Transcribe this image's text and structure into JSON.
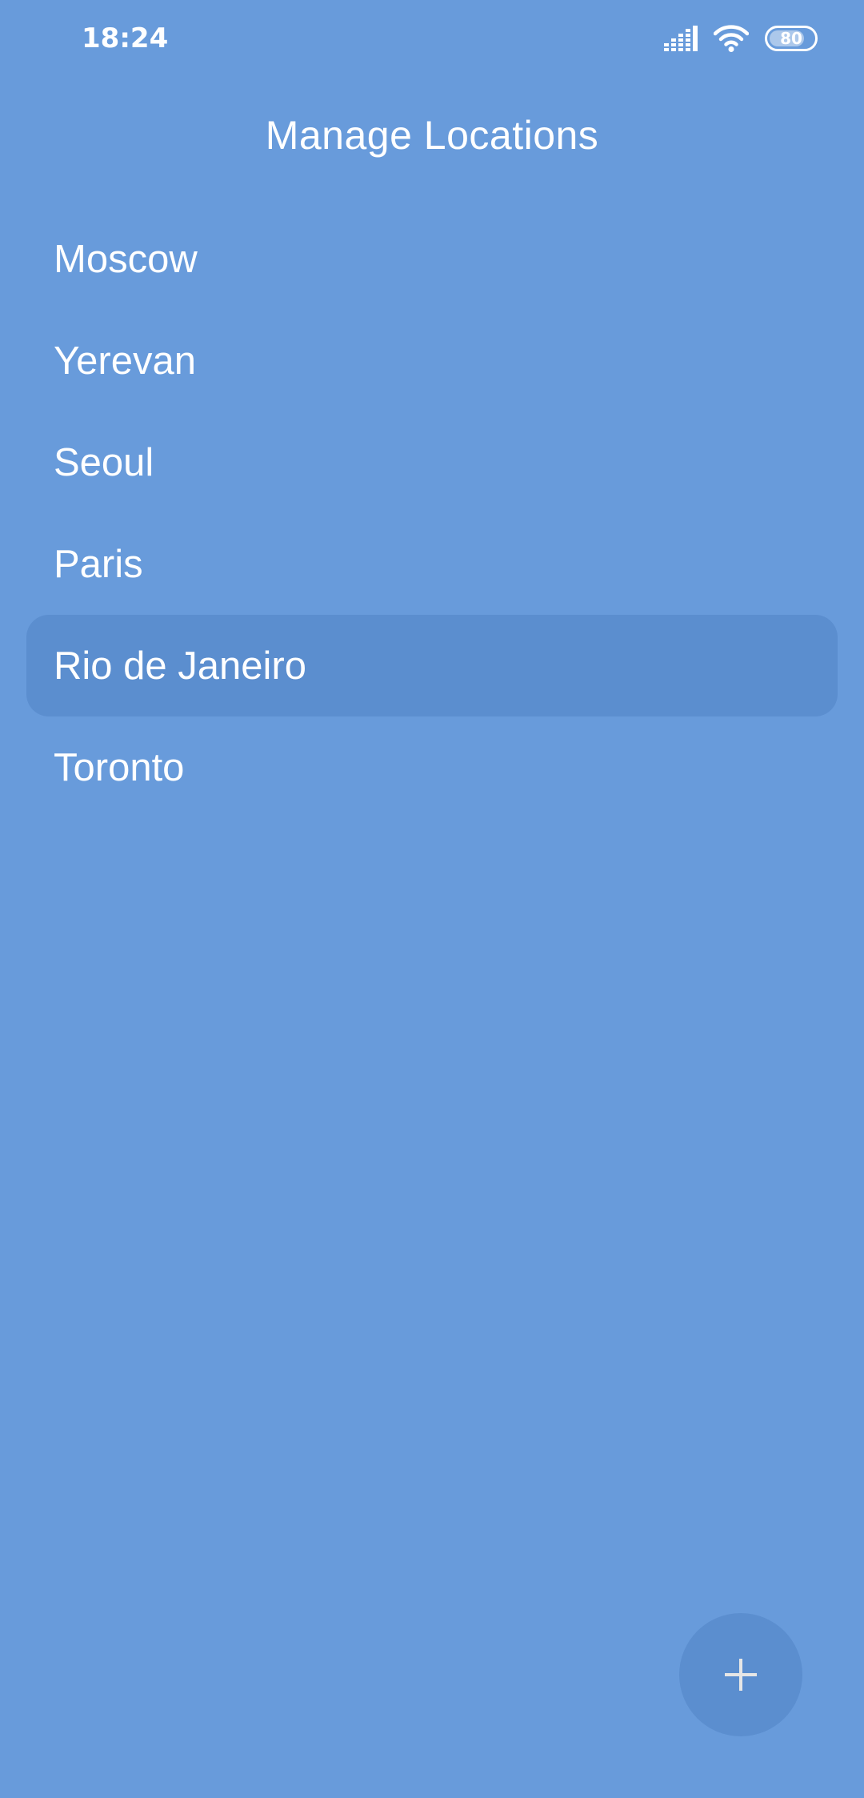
{
  "status_bar": {
    "time": "18:24",
    "signal_icon": "signal-icon",
    "wifi_icon": "wifi-icon",
    "battery_level": "80",
    "battery_fraction": 0.8
  },
  "header": {
    "title": "Manage Locations"
  },
  "locations": [
    {
      "name": "Moscow",
      "selected": false
    },
    {
      "name": "Yerevan",
      "selected": false
    },
    {
      "name": "Seoul",
      "selected": false
    },
    {
      "name": "Paris",
      "selected": false
    },
    {
      "name": "Rio de Janeiro",
      "selected": true
    },
    {
      "name": "Toronto",
      "selected": false
    }
  ],
  "fab": {
    "icon": "plus-icon"
  },
  "colors": {
    "background": "#689bdb",
    "selected_row": "#5b8ecf",
    "fab_background": "#5b8ecf",
    "text": "#ffffff",
    "fab_icon": "#e6e6e6"
  }
}
